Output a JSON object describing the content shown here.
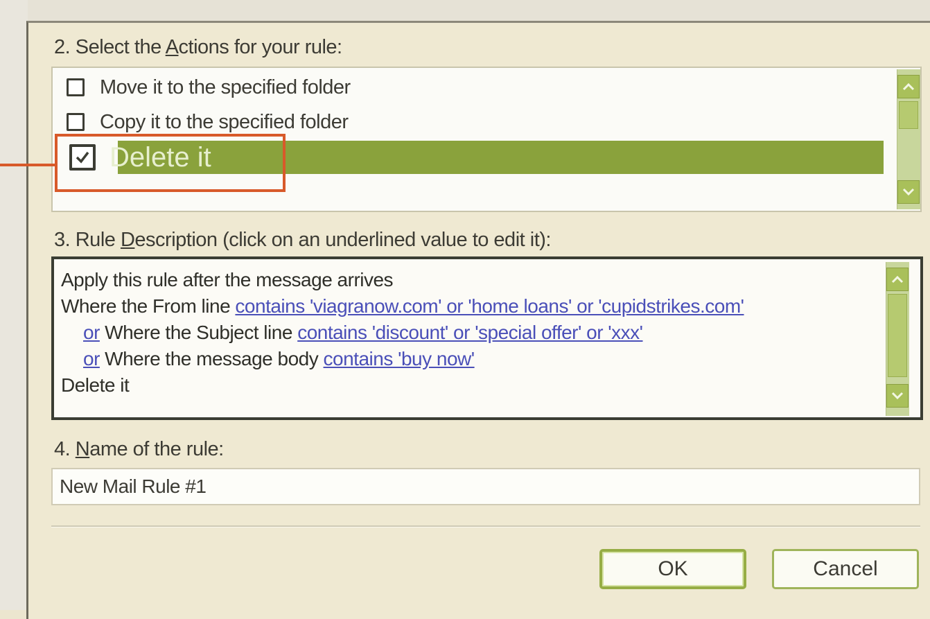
{
  "dialog": {
    "actions_label_prefix": "2. Select the ",
    "actions_label_mnemonic": "A",
    "actions_label_suffix": "ctions for your rule:",
    "actions": [
      {
        "label": "Move it to the specified folder",
        "checked": false
      },
      {
        "label": "Copy it to the specified folder",
        "checked": false
      },
      {
        "label": "Delete it",
        "checked": true,
        "selected": true
      }
    ],
    "description_label_prefix": "3. Rule ",
    "description_label_mnemonic": "D",
    "description_label_suffix": "escription (click on an underlined value to edit it):",
    "description": {
      "line1": "Apply this rule after the message arrives",
      "line2_text": "Where the From line ",
      "line2_link": "contains 'viagranow.com' or 'home loans' or 'cupidstrikes.com'",
      "line3_or": "or",
      "line3_text": " Where the Subject line ",
      "line3_link": "contains 'discount' or 'special offer' or 'xxx'",
      "line4_or": "or",
      "line4_text": " Where the message body ",
      "line4_link": "contains 'buy now'",
      "line5": "Delete it"
    },
    "name_label_prefix": "4. ",
    "name_label_mnemonic": "N",
    "name_label_suffix": "ame of the rule:",
    "rule_name": "New Mail Rule #1",
    "ok_label": "OK",
    "cancel_label": "Cancel"
  },
  "colors": {
    "selection": "#8aa23c",
    "callout": "#d85a2a",
    "link": "#4a4fb8"
  },
  "icons": {
    "scroll_up": "chevron-up-icon",
    "scroll_down": "chevron-down-icon",
    "checkbox_checked": "check-icon"
  }
}
